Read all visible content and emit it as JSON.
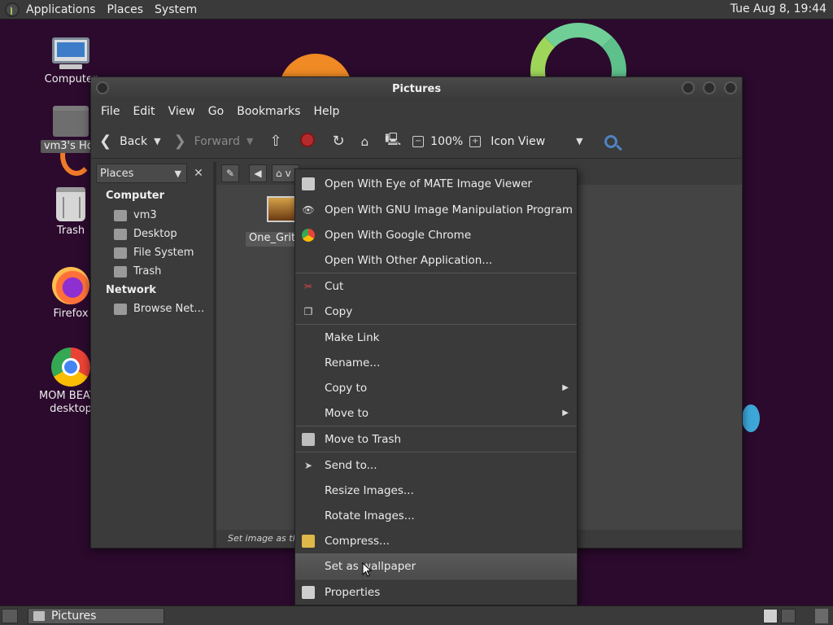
{
  "top_panel": {
    "menus": [
      "Applications",
      "Places",
      "System"
    ],
    "clock": "Tue Aug  8, 19:44"
  },
  "desktop_icons": [
    {
      "label": "Computer",
      "icon": "computer-icon"
    },
    {
      "label": "vm3's Hor",
      "icon": "home-folder-icon"
    },
    {
      "label": "Trash",
      "icon": "trash-icon"
    },
    {
      "label": "Firefox",
      "icon": "firefox-icon"
    },
    {
      "label": "MOM BEATS",
      "label2": "desktop",
      "icon": "chrome-icon"
    }
  ],
  "window": {
    "title": "Pictures",
    "menubar": [
      "File",
      "Edit",
      "View",
      "Go",
      "Bookmarks",
      "Help"
    ],
    "toolbar": {
      "back": "Back",
      "forward": "Forward",
      "zoom": "100%",
      "view_mode": "Icon View"
    },
    "sidebar": {
      "header": "Places",
      "sections": [
        {
          "title": "Computer",
          "items": [
            "vm3",
            "Desktop",
            "File System",
            "Trash"
          ]
        },
        {
          "title": "Network",
          "items": [
            "Browse Net…"
          ]
        }
      ]
    },
    "location": {
      "crumb": "v"
    },
    "file": {
      "name": "One_Grit."
    },
    "status": "Set image as the"
  },
  "context_menu": {
    "items": [
      {
        "label": "Open With Eye of MATE Image Viewer",
        "icon": "image-viewer-icon"
      },
      {
        "label": "Open With GNU Image Manipulation Program",
        "icon": "gimp-icon"
      },
      {
        "label": "Open With Google Chrome",
        "icon": "chrome-icon"
      },
      {
        "label": "Open With Other Application...",
        "icon": ""
      },
      {
        "label": "Cut",
        "icon": "scissors-icon"
      },
      {
        "label": "Copy",
        "icon": "copy-icon"
      },
      {
        "label": "Make Link",
        "icon": ""
      },
      {
        "label": "Rename...",
        "icon": ""
      },
      {
        "label": "Copy to",
        "icon": "",
        "submenu": true
      },
      {
        "label": "Move to",
        "icon": "",
        "submenu": true
      },
      {
        "label": "Move to Trash",
        "icon": "trash-icon"
      },
      {
        "label": "Send to...",
        "icon": "send-icon"
      },
      {
        "label": "Resize Images...",
        "icon": ""
      },
      {
        "label": "Rotate Images...",
        "icon": ""
      },
      {
        "label": "Compress...",
        "icon": "archive-icon"
      },
      {
        "label": "Set as wallpaper",
        "icon": "",
        "highlighted": true
      },
      {
        "label": "Properties",
        "icon": "properties-icon"
      }
    ]
  },
  "bottom_panel": {
    "task": "Pictures"
  },
  "colors": {
    "desktop_bg": "#2b0a2d",
    "panel_bg": "#3a3a3a",
    "menu_highlight": "#555555"
  }
}
